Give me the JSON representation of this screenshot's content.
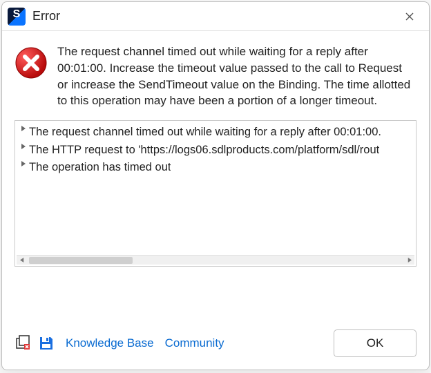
{
  "window": {
    "title": "Error"
  },
  "message": {
    "body": "The request channel timed out while waiting for a reply after 00:01:00. Increase the timeout value passed to the call to Request or increase the SendTimeout value on the Binding. The time allotted to this operation may have been a portion of a longer timeout."
  },
  "details": {
    "items": [
      "The request channel timed out while waiting for a reply after 00:01:00.",
      "The HTTP request to 'https://logs06.sdlproducts.com/platform/sdl/rout",
      "The operation has timed out"
    ]
  },
  "footer": {
    "knowledge_base": "Knowledge Base",
    "community": "Community",
    "ok": "OK"
  }
}
